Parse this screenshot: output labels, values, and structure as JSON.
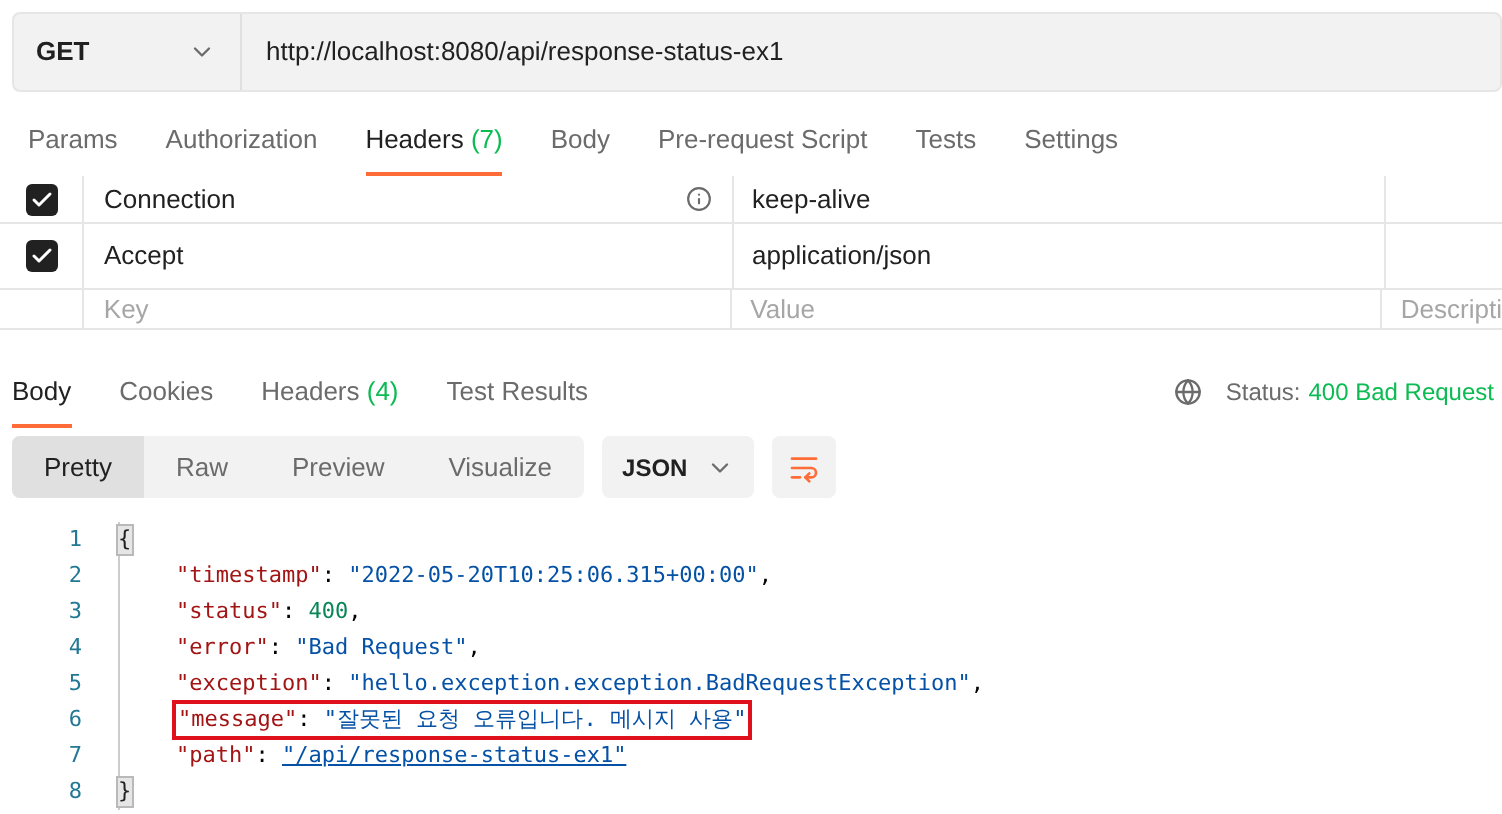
{
  "request": {
    "method": "GET",
    "url": "http://localhost:8080/api/response-status-ex1"
  },
  "request_tabs": [
    {
      "label": "Params",
      "selected": false
    },
    {
      "label": "Authorization",
      "selected": false
    },
    {
      "label": "Headers",
      "count": "(7)",
      "selected": true
    },
    {
      "label": "Body",
      "selected": false
    },
    {
      "label": "Pre-request Script",
      "selected": false
    },
    {
      "label": "Tests",
      "selected": false
    },
    {
      "label": "Settings",
      "selected": false
    }
  ],
  "headers": {
    "rows": [
      {
        "checked": true,
        "key": "Connection",
        "info": true,
        "value": "keep-alive"
      },
      {
        "checked": true,
        "key": "Accept",
        "info": false,
        "value": "application/json"
      }
    ],
    "new_row": {
      "key_placeholder": "Key",
      "value_placeholder": "Value",
      "description_placeholder": "Descripti"
    }
  },
  "response_tabs": [
    {
      "label": "Body",
      "selected": true
    },
    {
      "label": "Cookies",
      "selected": false
    },
    {
      "label": "Headers",
      "count": "(4)",
      "selected": false
    },
    {
      "label": "Test Results",
      "selected": false
    }
  ],
  "status": {
    "label": "Status:",
    "value": "400 Bad Request"
  },
  "view_modes": [
    {
      "label": "Pretty",
      "selected": true
    },
    {
      "label": "Raw",
      "selected": false
    },
    {
      "label": "Preview",
      "selected": false
    },
    {
      "label": "Visualize",
      "selected": false
    }
  ],
  "format": "JSON",
  "code_lines": [
    {
      "number": "1",
      "kind": "brace",
      "text": "{"
    },
    {
      "number": "2",
      "kind": "string",
      "key": "\"timestamp\"",
      "sep": ": ",
      "value": "\"2022-05-20T10:25:06.315+00:00\"",
      "end": ",",
      "highlighted": false
    },
    {
      "number": "3",
      "kind": "number",
      "key": "\"status\"",
      "sep": ": ",
      "value": "400",
      "end": ",",
      "highlighted": false
    },
    {
      "number": "4",
      "kind": "string",
      "key": "\"error\"",
      "sep": ": ",
      "value": "\"Bad Request\"",
      "end": ",",
      "highlighted": false
    },
    {
      "number": "5",
      "kind": "string",
      "key": "\"exception\"",
      "sep": ": ",
      "value": "\"hello.exception.exception.BadRequestException\"",
      "end": ",",
      "highlighted": false
    },
    {
      "number": "6",
      "kind": "string",
      "key": "\"message\"",
      "sep": ": ",
      "value": "\"잘못된 요청 오류입니다. 메시지 사용\"",
      "highlighted": true
    },
    {
      "number": "7",
      "kind": "link",
      "key": "\"path\"",
      "sep": ": ",
      "value": "\"/api/response-status-ex1\"",
      "highlighted": false
    },
    {
      "number": "8",
      "kind": "brace",
      "text": "}"
    }
  ]
}
